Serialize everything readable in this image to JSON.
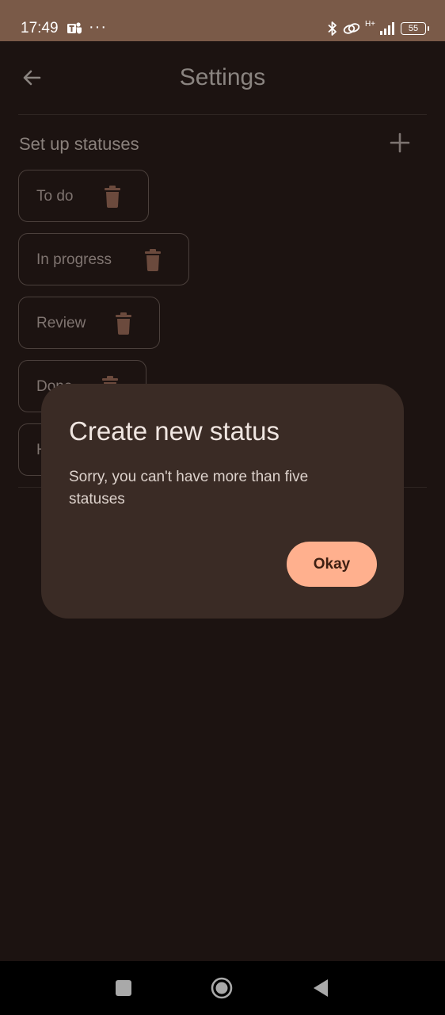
{
  "status_bar": {
    "time": "17:49",
    "dots": "···",
    "network": "H+",
    "battery": "55"
  },
  "app_bar": {
    "title": "Settings",
    "back_icon": "arrow-left-icon"
  },
  "section": {
    "title": "Set up statuses",
    "add_icon": "plus-icon"
  },
  "statuses": [
    {
      "label": "To do"
    },
    {
      "label": "In progress"
    },
    {
      "label": "Review"
    },
    {
      "label": "Done"
    },
    {
      "label": "H"
    }
  ],
  "dialog": {
    "title": "Create new status",
    "message": "Sorry, you can't have more than five statuses",
    "button_label": "Okay"
  },
  "colors": {
    "background": "#1c1311",
    "status_bar": "#7a5a48",
    "dialog": "#3a2b25",
    "accent": "#ffb08e",
    "trash": "#6b4a3d"
  }
}
